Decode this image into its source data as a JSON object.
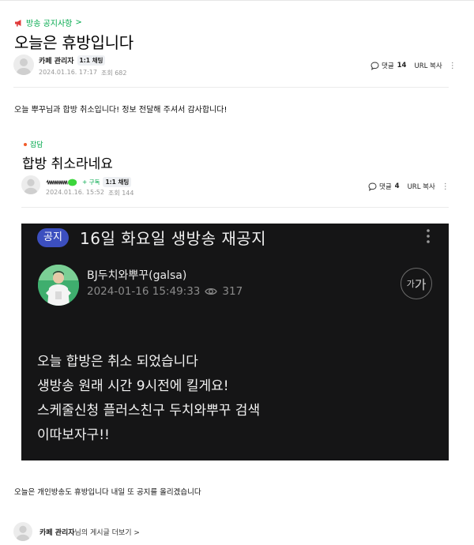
{
  "post": {
    "board_label": "방송 공지사항",
    "title": "오늘은 휴방입니다",
    "author": "카페 관리자",
    "chat_badge": "1:1 채팅",
    "date": "2024.01.16. 17:17",
    "views": "조회 682",
    "comments_label": "댓글",
    "comments_count": "14",
    "copy_url": "URL 복사",
    "body": "오늘 뿌꾸님과 합방 취소입니다! 정보 전달해 주셔서 감사합니다!"
  },
  "quoted": {
    "board_label": "잡담",
    "title": "합방 취소라네요",
    "subscribe": "+ 구독",
    "chat_badge": "1:1 채팅",
    "date": "2024.01.16. 15:52",
    "views": "조회 144",
    "comments_label": "댓글",
    "comments_count": "4",
    "copy_url": "URL 복사"
  },
  "screenshot": {
    "badge": "공지",
    "title": "16일 화요일 생방송 재공지",
    "broadcaster": "BJ두치와뿌꾸(galsa)",
    "datetime": "2024-01-16 15:49:33",
    "view_count": "317",
    "font_button_small": "가",
    "font_button_big": "가",
    "lines": [
      "오늘 합방은 취소 되었습니다",
      "생방송 원래 시간 9시전에 킬게요!",
      "스케줄신청 플러스친구 두치와뿌꾸 검색",
      "이따보자구!!"
    ]
  },
  "bottom": {
    "text": "오늘은 개인방송도 휴방입니다 내일 또 공지를 올리겠습니다",
    "author": "카페 관리자",
    "more_posts": "님의 게시글 더보기 >"
  },
  "colors": {
    "accent_green": "#03a94d",
    "screenshot_bg": "#151516",
    "notice_badge": "#3c4fbf"
  }
}
